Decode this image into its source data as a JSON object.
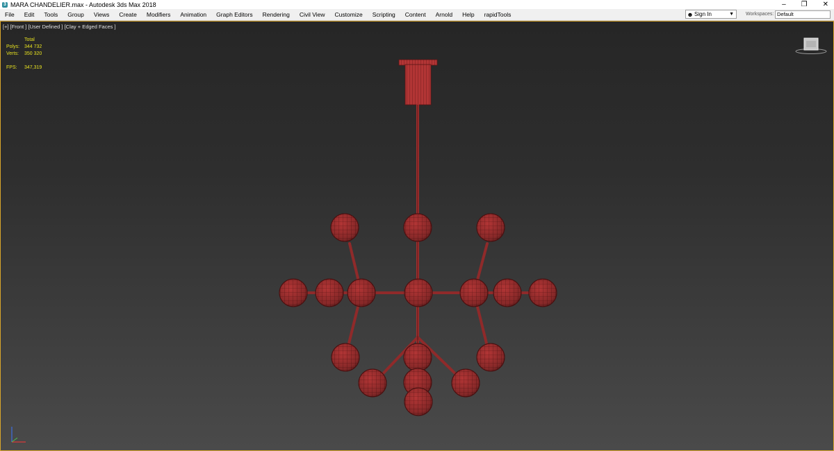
{
  "window": {
    "title": "MARA CHANDELIER.max - Autodesk 3ds Max 2018",
    "controls": {
      "minimize": "–",
      "restore": "❐",
      "close": "✕"
    }
  },
  "menubar": {
    "items": [
      "File",
      "Edit",
      "Tools",
      "Group",
      "Views",
      "Create",
      "Modifiers",
      "Animation",
      "Graph Editors",
      "Rendering",
      "Civil View",
      "Customize",
      "Scripting",
      "Content",
      "Arnold",
      "Help",
      "rapidTools"
    ]
  },
  "account": {
    "sign_in_label": "Sign In"
  },
  "workspaces": {
    "label": "Workspaces:",
    "value": "Default"
  },
  "viewport": {
    "label": "[+] [Front ] [User Defined ] [Clay + Edged Faces ]",
    "stats": {
      "header": "Total",
      "polys_label": "Polys:",
      "polys": "344 732",
      "verts_label": "Verts:",
      "verts": "350 320",
      "fps_label": "FPS:",
      "fps": "347,319"
    },
    "model_color": "#b23535",
    "border_color": "#d9a62b",
    "icons": {
      "viewcube": "viewcube-icon",
      "axis": "axis-tripod-icon"
    }
  }
}
